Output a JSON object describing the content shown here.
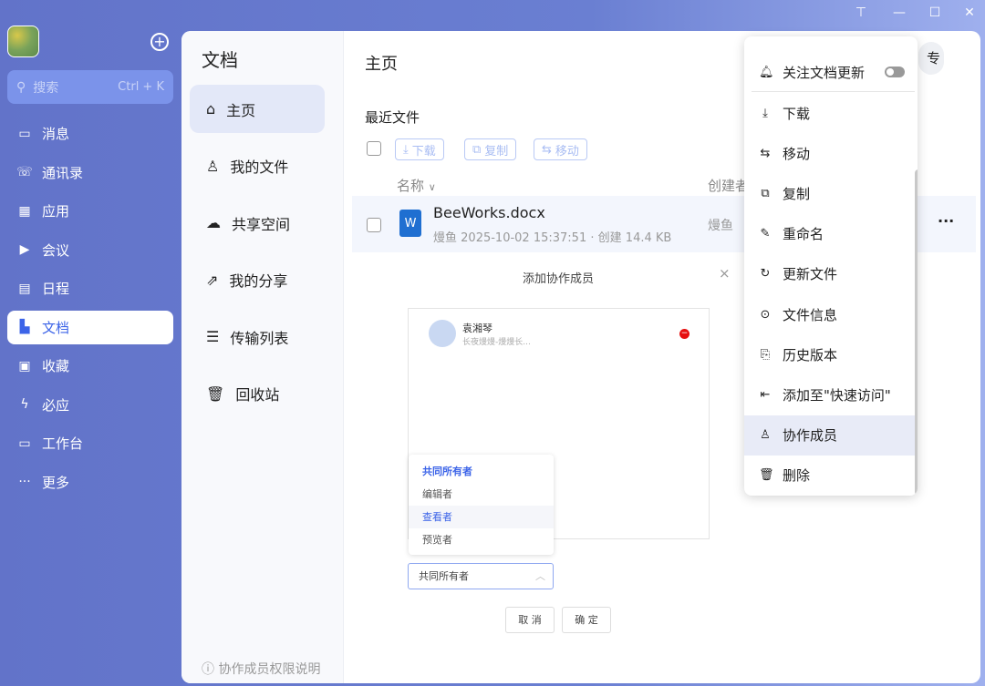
{
  "window": {
    "pin": "⊤",
    "minimize": "—",
    "maximize": "☐",
    "close": "✕"
  },
  "sidebar": {
    "search_placeholder": "搜索",
    "search_shortcut": "Ctrl + K",
    "items": [
      {
        "label": "消息",
        "icon": "message-icon"
      },
      {
        "label": "通讯录",
        "icon": "contacts-icon"
      },
      {
        "label": "应用",
        "icon": "apps-icon"
      },
      {
        "label": "会议",
        "icon": "meeting-icon"
      },
      {
        "label": "日程",
        "icon": "calendar-icon"
      },
      {
        "label": "文档",
        "icon": "docs-icon",
        "active": true
      },
      {
        "label": "收藏",
        "icon": "favorites-icon"
      },
      {
        "label": "必应",
        "icon": "ding-icon"
      },
      {
        "label": "工作台",
        "icon": "workbench-icon"
      },
      {
        "label": "更多",
        "icon": "more-icon"
      }
    ]
  },
  "docs_nav": {
    "title": "文档",
    "items": [
      {
        "label": "主页",
        "active": true
      },
      {
        "label": "我的文件"
      },
      {
        "label": "共享空间"
      },
      {
        "label": "我的分享"
      },
      {
        "label": "传输列表"
      },
      {
        "label": "回收站"
      }
    ],
    "footer": "协作成员权限说明"
  },
  "main": {
    "title": "主页",
    "section": "最近文件",
    "toolbar": {
      "download": "下载",
      "copy": "复制",
      "move": "移动"
    },
    "col_name": "名称",
    "col_creator": "创建者",
    "avatar_text": "专",
    "file": {
      "name": "BeeWorks.docx",
      "owner": "熳鱼",
      "datetime": "2025-10-02 15:37:51",
      "action": "创建",
      "size": "14.4 KB",
      "creator": "熳鱼",
      "more": "···"
    }
  },
  "dialog": {
    "title": "添加协作成员",
    "close": "×",
    "member": {
      "name": "袁湘琴",
      "dept": "长夜熳熳-熳熳长..."
    },
    "role_options": [
      "共同所有者",
      "编辑者",
      "查看者",
      "预览者"
    ],
    "role_selected": "共同所有者",
    "cancel": "取 消",
    "ok": "确 定"
  },
  "context_menu": {
    "follow": "关注文档更新",
    "follow_on": false,
    "items": [
      "下载",
      "移动",
      "复制",
      "重命名",
      "更新文件",
      "文件信息",
      "历史版本",
      "添加至\"快速访问\"",
      "协作成员",
      "删除"
    ]
  }
}
